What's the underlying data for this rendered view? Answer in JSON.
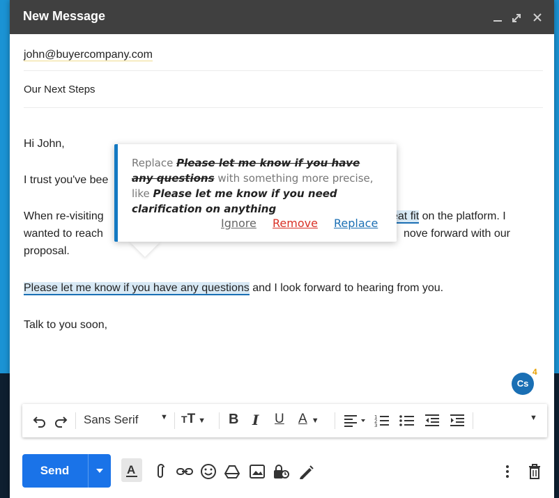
{
  "window": {
    "title": "New Message",
    "controls": [
      "minimize-icon",
      "expand-icon",
      "close-icon"
    ]
  },
  "compose": {
    "to": "john@buyercompany.com",
    "subject": "Our Next Steps"
  },
  "body": {
    "greeting": "Hi John,",
    "line2": "I trust you've bee",
    "para_a1": "When re-visiting ",
    "para_a_hl": "eat fit",
    "para_a_tail": " on the platform. I",
    "para_b1": "wanted to reach ",
    "para_b_tail": "nove forward with our",
    "para_c": "proposal.",
    "highlight_sentence": "Please let me know if you have any questions",
    "sentence_rest": " and I look forward to hearing from you.",
    "signoff": "Talk to you soon,"
  },
  "suggestion": {
    "prefix": "Replace ",
    "original": "Please let me know if you have any questions",
    "middle": " with something more precise, like ",
    "replacement": "Please let me know if you need clarification on anything",
    "ignore": "Ignore",
    "remove": "Remove",
    "replace": "Replace"
  },
  "assistant": {
    "badge": "Cs",
    "count": "4"
  },
  "toolbar": {
    "font": "Sans Serif",
    "icons": [
      "undo-icon",
      "redo-icon",
      "font-dropdown",
      "text-size-icon",
      "bold-icon",
      "italic-icon",
      "underline-icon",
      "text-color-icon",
      "align-icon",
      "numbered-list-icon",
      "bulleted-list-icon",
      "indent-less-icon",
      "indent-more-icon",
      "more-formatting-icon"
    ]
  },
  "bottom": {
    "send": "Send",
    "icons": [
      "formatting-icon",
      "attach-icon",
      "link-icon",
      "emoji-icon",
      "drive-icon",
      "photo-icon",
      "confidential-icon",
      "signature-icon",
      "more-options-icon",
      "trash-icon"
    ]
  },
  "colors": {
    "accent": "#1a73e8",
    "highlight_underline": "#1a6fb4",
    "remove_red": "#d93025",
    "replace_blue": "#1a6fb4"
  }
}
